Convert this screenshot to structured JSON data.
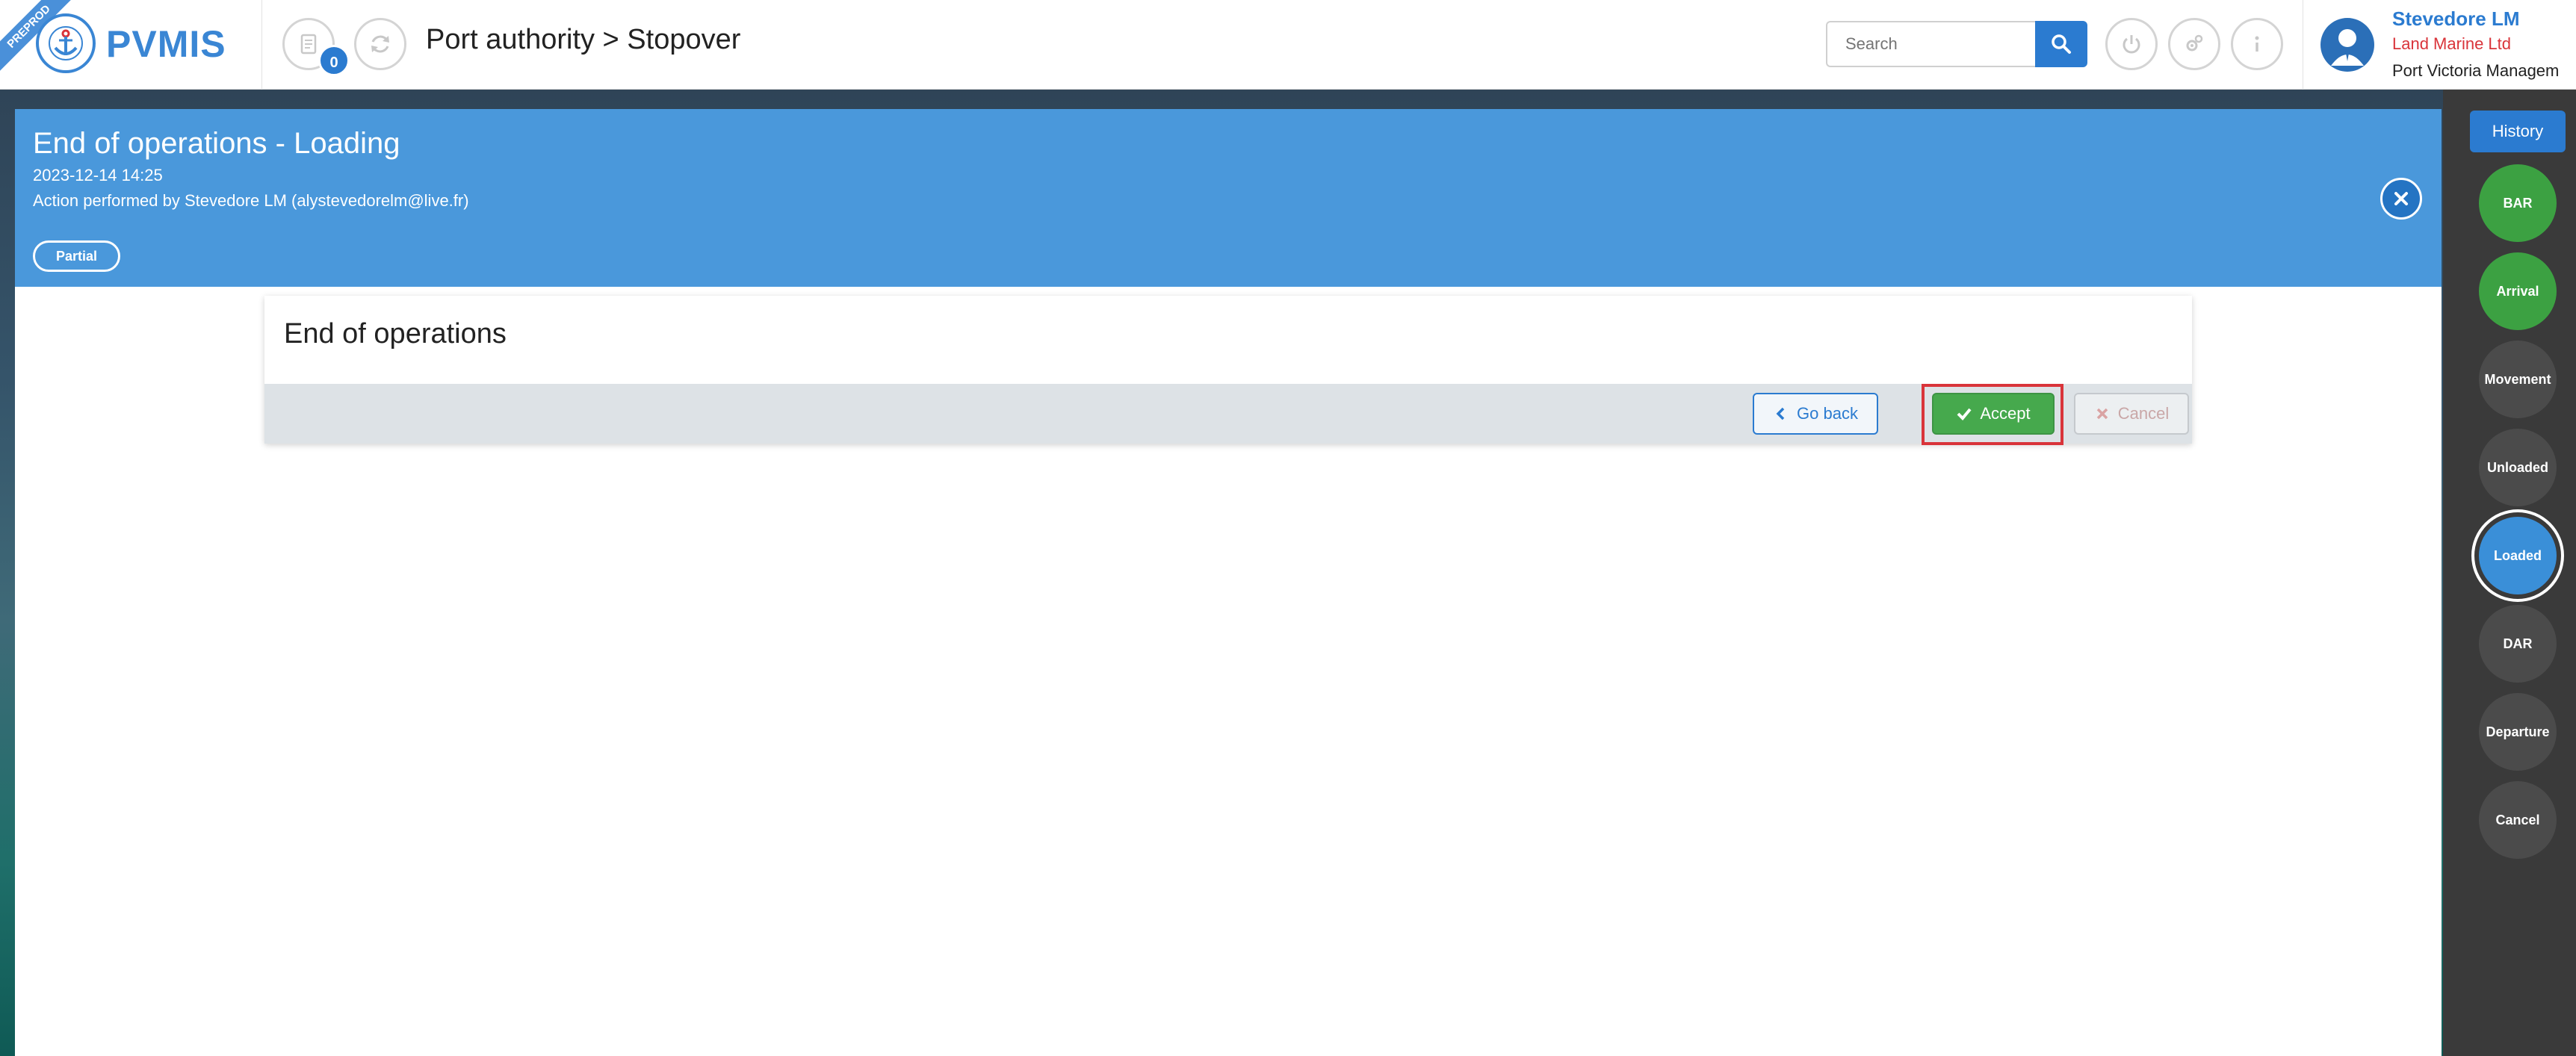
{
  "app": {
    "env_ribbon": "PREPROD",
    "logo_text": "PVMIS",
    "breadcrumb": "Port authority > Stopover",
    "notification_count": "0"
  },
  "search": {
    "placeholder": "Search"
  },
  "user": {
    "name": "Stevedore LM",
    "company": "Land Marine Ltd",
    "organization": "Port Victoria Managem"
  },
  "panel": {
    "title": "End of operations - Loading",
    "date": "2023-12-14 14:25",
    "action": "Action performed by Stevedore LM (alystevedorelm@live.fr)",
    "status_pill": "Partial"
  },
  "card": {
    "title": "End of operations",
    "go_back_label": "Go back",
    "accept_label": "Accept",
    "cancel_label": "Cancel"
  },
  "timeline": {
    "history_label": "History",
    "steps": [
      {
        "label": "BAR",
        "state": "done"
      },
      {
        "label": "Arrival",
        "state": "done"
      },
      {
        "label": "Movement",
        "state": "pending"
      },
      {
        "label": "Unloaded",
        "state": "pending"
      },
      {
        "label": "Loaded",
        "state": "active"
      },
      {
        "label": "DAR",
        "state": "pending"
      },
      {
        "label": "Departure",
        "state": "pending"
      },
      {
        "label": "Cancel",
        "state": "pending"
      }
    ]
  },
  "colors": {
    "accent": "#2b7bd0",
    "header_blue": "#4a98db",
    "success_green": "#46a94d",
    "highlight_red": "#d9343a"
  }
}
